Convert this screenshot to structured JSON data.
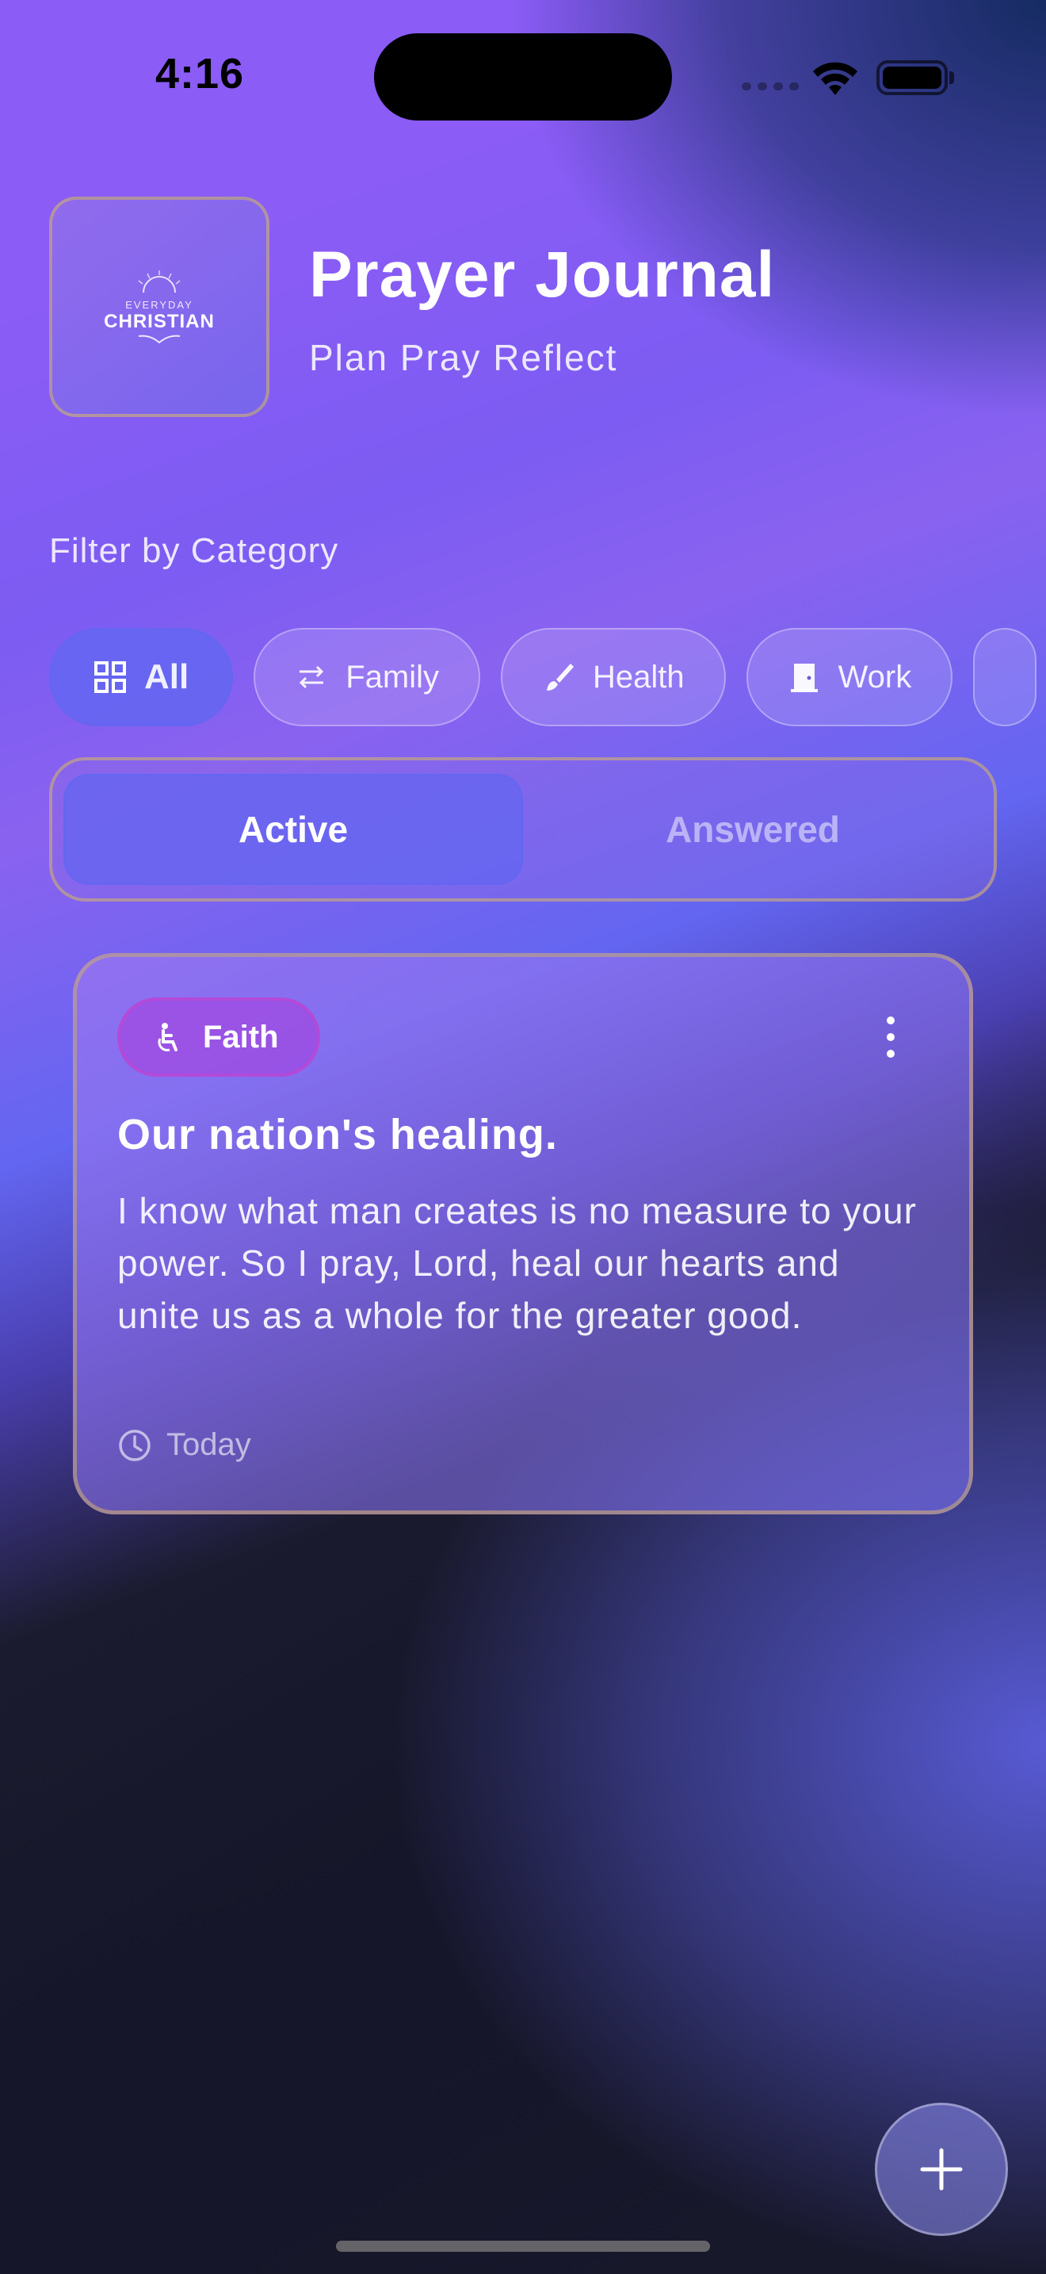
{
  "status_bar": {
    "time": "4:16"
  },
  "header": {
    "logo_small_text": "EVERYDAY",
    "logo_big_text": "CHRISTIAN",
    "title": "Prayer Journal",
    "subtitle": "Plan Pray Reflect"
  },
  "filter": {
    "label": "Filter by Category",
    "chips": [
      {
        "label": "All",
        "icon": "grid-icon",
        "active": true
      },
      {
        "label": "Family",
        "icon": "arrows-icon",
        "active": false
      },
      {
        "label": "Health",
        "icon": "brush-icon",
        "active": false
      },
      {
        "label": "Work",
        "icon": "door-icon",
        "active": false
      }
    ]
  },
  "tabs": {
    "active": "Active",
    "answered": "Answered"
  },
  "prayers": [
    {
      "category": "Faith",
      "category_icon": "accessibility-icon",
      "title": "Our nation's healing.",
      "body": "I know what man creates is no measure to your power. So I pray, Lord, heal our hearts and unite us as a whole for the greater good.",
      "time": "Today"
    }
  ],
  "colors": {
    "accent": "#6366f1",
    "purple": "#8b5cf6",
    "faith_badge": "#b34ad8",
    "dark_bg": "#18182b"
  }
}
